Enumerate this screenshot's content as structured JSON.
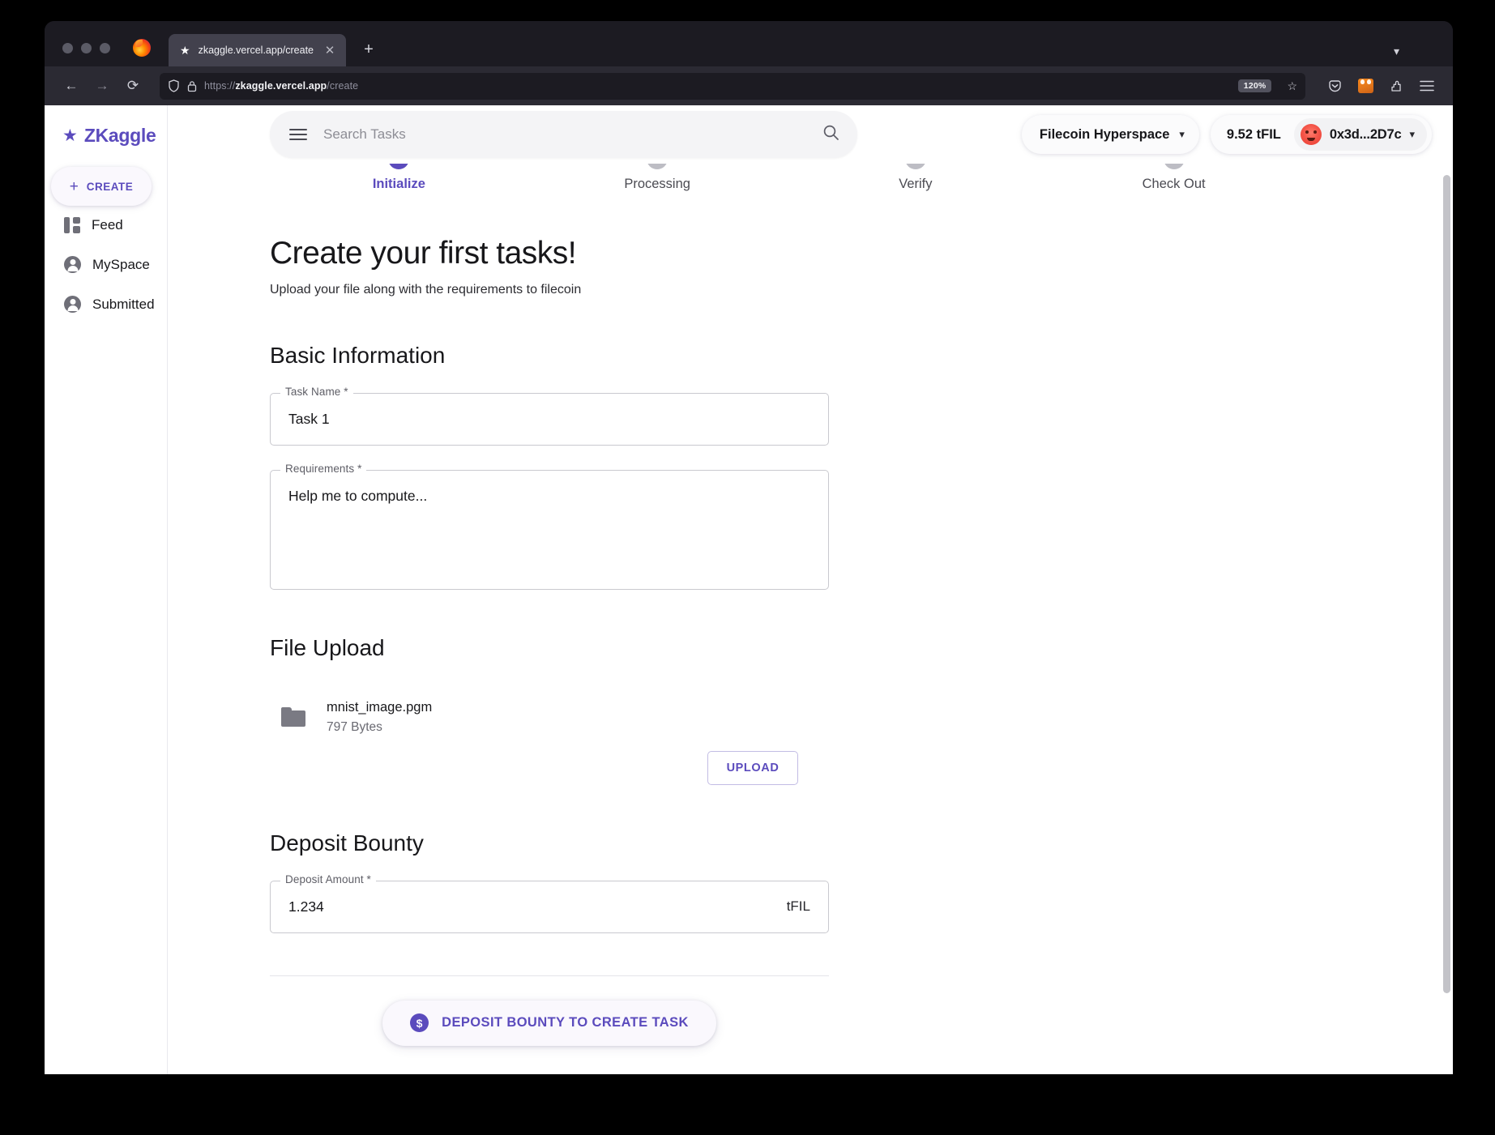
{
  "browser": {
    "tab": {
      "title": "zkaggle.vercel.app/create",
      "star_icon": "star-icon",
      "close_icon": "close-icon"
    },
    "new_tab_label": "+",
    "tabstrip_chevron": "chevron-down-icon",
    "nav": {
      "back": "←",
      "forward": "→",
      "reload": "⟳"
    },
    "url": {
      "scheme": "https://",
      "host": "zkaggle.vercel.app",
      "path": "/create"
    },
    "zoom_level": "120%",
    "bookmark_star": "☆",
    "toolbar_icons": [
      "pocket-icon",
      "metamask-icon",
      "extensions-icon",
      "app-menu-icon"
    ]
  },
  "sidebar": {
    "brand": {
      "star": "★",
      "name": "ZKaggle"
    },
    "create_button": {
      "plus": "+",
      "label": "CREATE"
    },
    "items": [
      {
        "label": "Feed",
        "icon": "feed-icon"
      },
      {
        "label": "MySpace",
        "icon": "person-icon"
      },
      {
        "label": "Submitted",
        "icon": "person-icon"
      }
    ]
  },
  "topbar": {
    "search": {
      "placeholder": "Search Tasks",
      "value": "",
      "menu_icon": "hamburger-icon",
      "search_icon": "search-icon"
    },
    "network": {
      "name": "Filecoin Hyperspace",
      "chevron": "⌄"
    },
    "wallet": {
      "balance": "9.52 tFIL",
      "address": "0x3d...2D7c",
      "chevron": "⌄",
      "avatar": "blockie-avatar"
    }
  },
  "stepper": {
    "steps": [
      {
        "label": "Initialize",
        "active": true
      },
      {
        "label": "Processing",
        "active": false
      },
      {
        "label": "Verify",
        "active": false
      },
      {
        "label": "Check Out",
        "active": false
      }
    ]
  },
  "main": {
    "title": "Create your first tasks!",
    "subtitle": "Upload your file along with the requirements to filecoin",
    "sections": {
      "basic_information": {
        "heading": "Basic Information",
        "task_name": {
          "legend": "Task Name *",
          "value": "Task 1"
        },
        "requirements": {
          "legend": "Requirements *",
          "value": "Help me to compute..."
        }
      },
      "file_upload": {
        "heading": "File Upload",
        "file": {
          "name": "mnist_image.pgm",
          "size": "797 Bytes",
          "icon": "folder-icon"
        },
        "upload_button": "UPLOAD"
      },
      "deposit_bounty": {
        "heading": "Deposit Bounty",
        "deposit_amount": {
          "legend": "Deposit Amount *",
          "value": "1.234",
          "unit": "tFIL"
        }
      }
    },
    "cta": {
      "label": "DEPOSIT BOUNTY TO CREATE TASK",
      "icon": "dollar-icon",
      "icon_glyph": "$"
    }
  },
  "colors": {
    "brand_purple": "#5b4bbd",
    "chrome_dark": "#1c1b22",
    "toolbar_dark": "#2b2a33",
    "page_bg": "#ffffff"
  }
}
